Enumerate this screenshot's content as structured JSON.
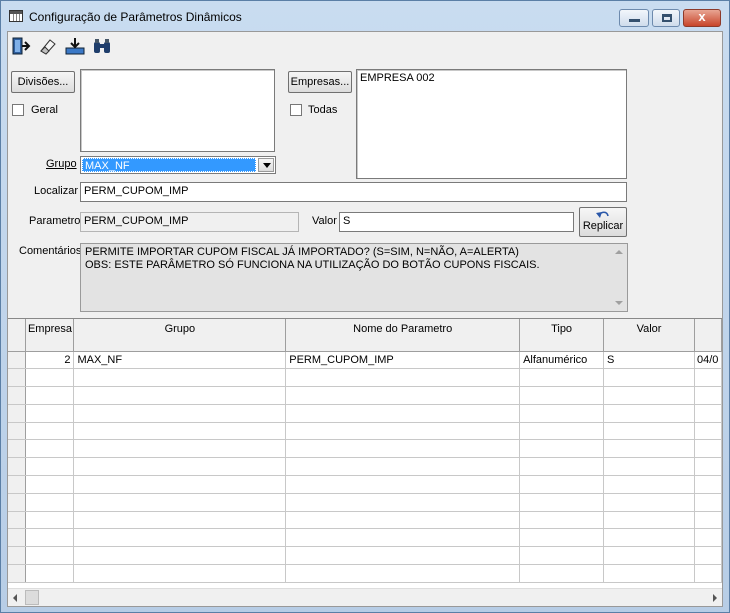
{
  "window": {
    "title": "Configuração de Parâmetros Dinâmicos",
    "close_glyph": "x"
  },
  "toolbar": {
    "icons": [
      "exit-icon",
      "eraser-icon",
      "save-download-icon",
      "binoculars-icon"
    ]
  },
  "divisoes": {
    "button_label": "Divisões...",
    "geral_label": "Geral",
    "geral_checked": false
  },
  "empresas": {
    "button_label": "Empresas...",
    "todas_label": "Todas",
    "todas_checked": false,
    "items": [
      "EMPRESA 002"
    ]
  },
  "grupo": {
    "label": "Grupo",
    "value": "MAX_NF"
  },
  "localizar": {
    "label": "Localizar",
    "value": "PERM_CUPOM_IMP"
  },
  "parametro": {
    "label": "Parametro",
    "value": "PERM_CUPOM_IMP"
  },
  "valor": {
    "label": "Valor",
    "value": "S"
  },
  "replicar": {
    "label": "Replicar"
  },
  "comentarios": {
    "label": "Comentários",
    "line1": "PERMITE IMPORTAR CUPOM FISCAL JÁ IMPORTADO? (S=SIM, N=NÃO, A=ALERTA)",
    "line2": "OBS: ESTE PARÂMETRO SÓ FUNCIONA NA UTILIZAÇÃO DO BOTÃO CUPONS FISCAIS."
  },
  "grid": {
    "columns": [
      "Empresa",
      "Grupo",
      "Nome do Parametro",
      "Tipo",
      "Valor"
    ],
    "rows": [
      {
        "empresa": "2",
        "grupo": "MAX_NF",
        "nome": "PERM_CUPOM_IMP",
        "tipo": "Alfanumérico",
        "valor": "S",
        "extra": "04/0"
      }
    ]
  }
}
